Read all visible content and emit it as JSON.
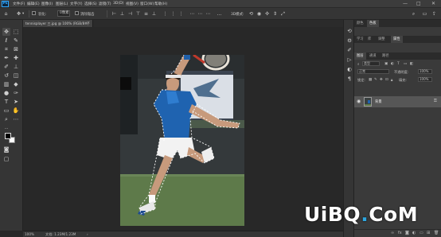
{
  "app": {
    "logo_text": "Ps"
  },
  "menu": [
    "文件(F)",
    "编辑(E)",
    "图像(I)",
    "图层(L)",
    "文字(Y)",
    "选择(S)",
    "滤镜(T)",
    "3D(D)",
    "视图(V)",
    "窗口(W)",
    "帮助(H)"
  ],
  "window_controls": {
    "minimize": "—",
    "maximize": "□",
    "close": "✕"
  },
  "options_bar": {
    "feather_label": "羽化:",
    "feather_value": "0像素",
    "anti_alias_label": "消除锯齿",
    "style_label": "样式:",
    "style_value": "正常",
    "width_label": "宽度:",
    "height_label": "高度:",
    "select_mask_label": "选择并遮住..."
  },
  "document": {
    "tab_title": "tennisplayer 三.jpg @ 100% (RGB/8#)",
    "close": "×"
  },
  "status": {
    "zoom": "100%",
    "doc_size": "文档: 1.23M/1.23M"
  },
  "panels": {
    "top_tabs": [
      "颜色",
      "色板"
    ],
    "adjust_tabs": [
      "学习",
      "库",
      "调整",
      "属性"
    ],
    "layer_tabs": [
      "图层",
      "通道",
      "路径"
    ],
    "kind_label": "类型",
    "blend_mode": "正常",
    "opacity_label": "不透明度:",
    "opacity_value": "100%",
    "lock_label": "锁定:",
    "fill_label": "填充:",
    "fill_value": "100%",
    "layer_name": "背景"
  },
  "watermark": {
    "part1": "UiBQ",
    "part2": ".",
    "part3": "CoM"
  }
}
